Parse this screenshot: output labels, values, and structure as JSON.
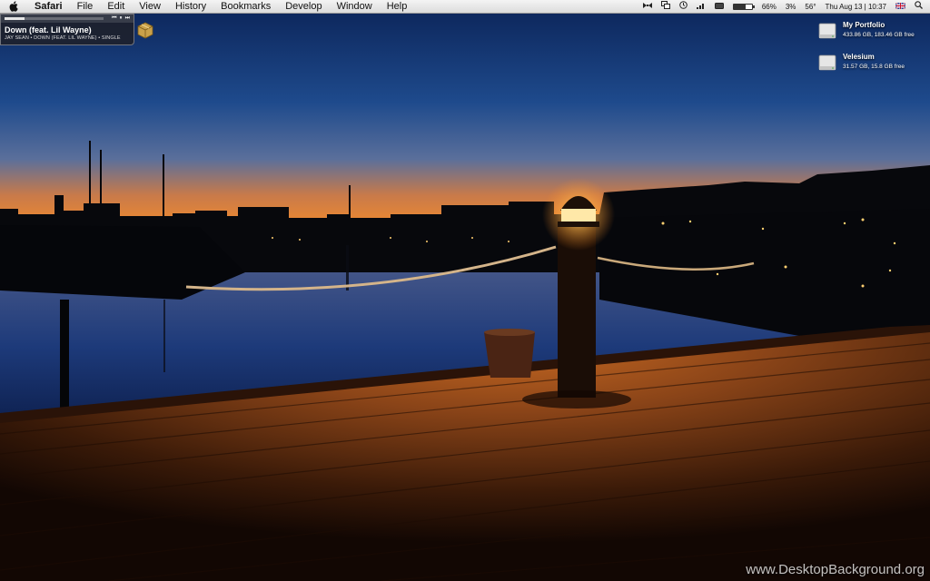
{
  "menubar": {
    "app_name": "Safari",
    "items": [
      "File",
      "Edit",
      "View",
      "History",
      "Bookmarks",
      "Develop",
      "Window",
      "Help"
    ],
    "status": {
      "volume_text": "",
      "cpu_percent": "66%",
      "battery_text": "3%",
      "temperature": "56°",
      "clock": "Thu Aug 13 | 10:37",
      "language_icon": "uk-flag-icon",
      "battery_level": 0.66
    }
  },
  "now_playing": {
    "title": "Down (feat. Lil Wayne)",
    "subtitle": "JAY SEAN • DOWN (FEAT. LIL WAYNE) • SINGLE",
    "progress": 0.2,
    "controls": [
      "⏮",
      "⏸",
      "⏭"
    ]
  },
  "drives": [
    {
      "name": "My Portfolio",
      "info": "433.86 GB, 183.46 GB free"
    },
    {
      "name": "Velesium",
      "info": "31.57 GB, 15.8 GB free"
    }
  ],
  "watermark": "www.DesktopBackground.org",
  "colors": {
    "sky_top": "#0d2a63",
    "sky_horizon": "#e0783a",
    "deck": "#8a4a1c"
  }
}
